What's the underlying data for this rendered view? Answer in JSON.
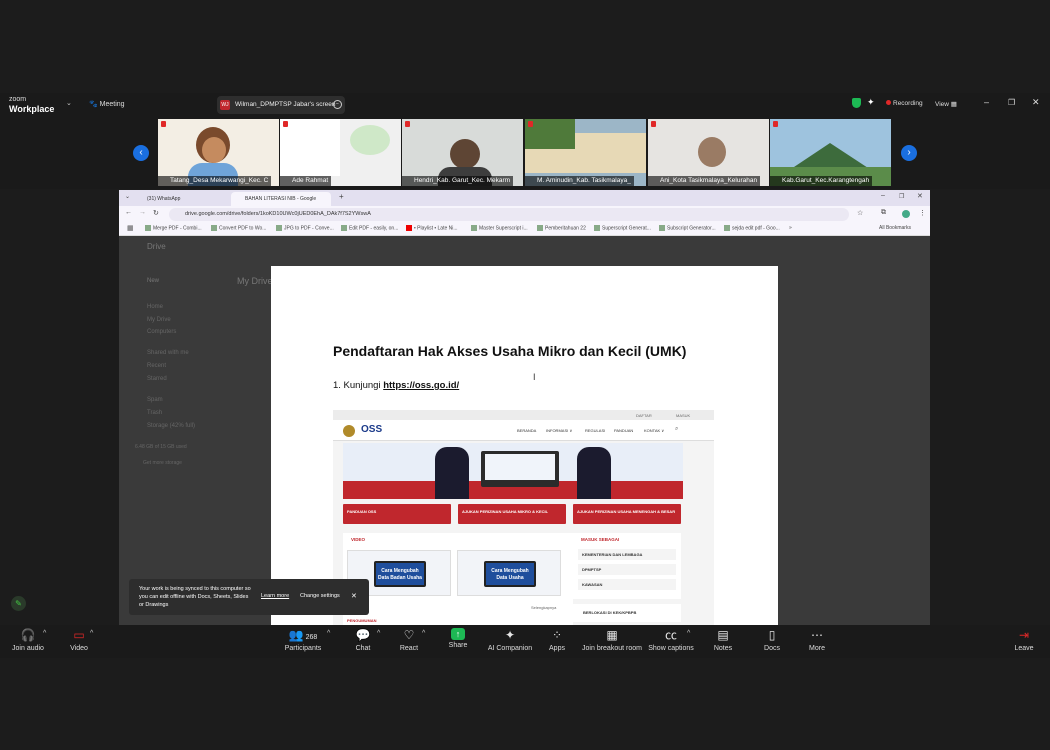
{
  "app": {
    "logo_top": "zoom",
    "logo_bottom": "Workplace",
    "meeting_label": "Meeting",
    "share_label": "Wilman_DPMPTSP Jabar's screen",
    "share_initials": "WJ",
    "recording_label": "Recording",
    "view_label": "View"
  },
  "participants": [
    {
      "name": "Tatang_Desa Mekarwangi_Kec. C"
    },
    {
      "name": "Ade Rahmat"
    },
    {
      "name": "Hendri_Kab. Garut_Kec. Mekarm"
    },
    {
      "name": "M. Aminudin_Kab. Tasikmalaya_"
    },
    {
      "name": "Ani_Kota Tasikmalaya_Kelurahan"
    },
    {
      "name": "Kab.Garut_Kec.Karangtengah"
    }
  ],
  "browser": {
    "tabs": [
      "(31) WhatsApp",
      "BAHAN LITERASI NIB - Google"
    ],
    "url": "drive.google.com/drive/folders/1koKD10UWc0jUED0EhA_DAk7f7S2YWswA",
    "bookmarks": [
      "Merge PDF - Combi...",
      "Convert PDF to Wo...",
      "JPG to PDF - Conve...",
      "Edit PDF - easily, on...",
      "• Playlist • Late Ni...",
      "Master Superscript i...",
      "Pemberitahuan 22",
      "Superscript Generat...",
      "Subscript Generator...",
      "sejda edit pdf - Goo...",
      "»"
    ],
    "all_bookmarks": "All Bookmarks"
  },
  "drive": {
    "title": "Drive",
    "new": "New",
    "my_drive": "My Drive",
    "side": [
      "Home",
      "My Drive",
      "Computers",
      "Shared with me",
      "Recent",
      "Starred",
      "Spam",
      "Trash",
      "Storage (42% full)"
    ],
    "storage": "6.48 GB of 15 GB used",
    "get_storage": "Get more storage"
  },
  "doc": {
    "title": "Pendaftaran Hak Akses Usaha Mikro dan Kecil (UMK)",
    "step1_prefix": "1. Kunjungi ",
    "step1_link": "https://oss.go.id/",
    "oss": {
      "top_links": [
        "DAFTAR",
        "MASUK"
      ],
      "logo": "OSS",
      "nav": [
        "BERANDA",
        "INFORMASI ∨",
        "REGULASI",
        "PANDUAN",
        "KONTAK ∨"
      ],
      "banners": [
        "PANDUAN OSS",
        "AJUKAN PERIZINAN USAHA MIKRO & KECIL",
        "AJUKAN PERIZINAN USAHA MENENGAH & BESAR"
      ],
      "video_label": "VIDEO",
      "videos": [
        "Cara Mengubah Data Badan Usaha",
        "Cara Mengubah Data Usaha"
      ],
      "more": "Selengkapnya",
      "login_label": "MASUK SEBAGAI",
      "login_items": [
        "KEMENTERIAN DAN LEMBAGA",
        "DPMPTSP",
        "KAWASAN"
      ],
      "kek": "BERLOKASI DI KEK/KPBPB",
      "announce": "PENGUMUMAN"
    }
  },
  "toast": {
    "message": "Your work is being synced to this computer so you can edit offline with Docs, Sheets, Slides or Drawings",
    "learn": "Learn more",
    "settings": "Change settings"
  },
  "toolbar": {
    "join_audio": "Join audio",
    "video": "Video",
    "participants": "Participants",
    "participants_count": "268",
    "chat": "Chat",
    "react": "React",
    "share": "Share",
    "ai": "AI Companion",
    "apps": "Apps",
    "breakout": "Join breakout room",
    "captions": "Show captions",
    "notes": "Notes",
    "docs": "Docs",
    "more": "More",
    "leave": "Leave"
  },
  "colors": {
    "accent": "#1a6fe0",
    "recording": "#e02828",
    "share": "#1db954",
    "oss_red": "#c0272d"
  }
}
